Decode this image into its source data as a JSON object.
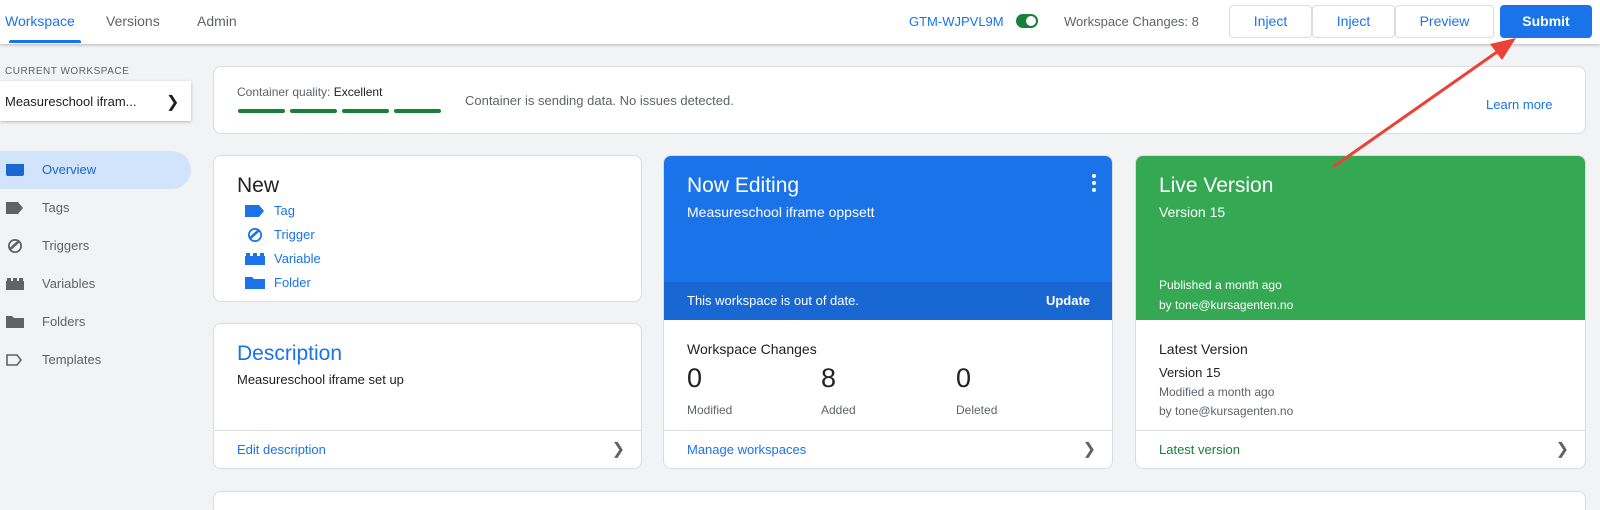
{
  "topbar": {
    "tabs": [
      {
        "label": "Workspace",
        "active": true
      },
      {
        "label": "Versions",
        "active": false
      },
      {
        "label": "Admin",
        "active": false
      }
    ],
    "container_id": "GTM-WJPVL9M",
    "workspace_changes": "Workspace Changes: 8",
    "buttons": {
      "inject_1": "Inject",
      "inject_2": "Inject",
      "preview": "Preview",
      "submit": "Submit"
    }
  },
  "sidebar": {
    "section_label": "CURRENT WORKSPACE",
    "workspace_name": "Measureschool ifram...",
    "items": [
      {
        "label": "Overview",
        "icon": "overview-icon",
        "active": true
      },
      {
        "label": "Tags",
        "icon": "tag-icon",
        "active": false
      },
      {
        "label": "Triggers",
        "icon": "trigger-icon",
        "active": false
      },
      {
        "label": "Variables",
        "icon": "variable-icon",
        "active": false
      },
      {
        "label": "Folders",
        "icon": "folder-icon",
        "active": false
      },
      {
        "label": "Templates",
        "icon": "template-icon",
        "active": false
      }
    ]
  },
  "quality": {
    "label": "Container quality:",
    "value": "Excellent",
    "message": "Container is sending data. No issues detected.",
    "learn_more": "Learn more"
  },
  "new_card": {
    "title": "New",
    "items": [
      {
        "label": "Tag",
        "icon": "tag-icon"
      },
      {
        "label": "Trigger",
        "icon": "trigger-icon"
      },
      {
        "label": "Variable",
        "icon": "variable-icon"
      },
      {
        "label": "Folder",
        "icon": "folder-icon"
      }
    ]
  },
  "description_card": {
    "title": "Description",
    "text": "Measureschool iframe set up",
    "link": "Edit description"
  },
  "editing_card": {
    "title": "Now Editing",
    "workspace": "Measureschool iframe oppsett",
    "out_of_date": "This workspace is out of date.",
    "update": "Update",
    "changes_title": "Workspace Changes",
    "stats": [
      {
        "value": "0",
        "label": "Modified"
      },
      {
        "value": "8",
        "label": "Added"
      },
      {
        "value": "0",
        "label": "Deleted"
      }
    ],
    "link": "Manage workspaces"
  },
  "live_card": {
    "title": "Live Version",
    "version": "Version 15",
    "published": "Published a month ago",
    "by": "by tone@kursagenten.no",
    "latest_title": "Latest Version",
    "latest_version": "Version 15",
    "modified": "Modified a month ago",
    "latest_by": "by tone@kursagenten.no",
    "link": "Latest version"
  },
  "colors": {
    "accent": "#1a73e8",
    "editing": "#1a73e8",
    "live": "#34a853",
    "quality_bar": "#188038",
    "annotation_arrow": "#ea4335"
  }
}
